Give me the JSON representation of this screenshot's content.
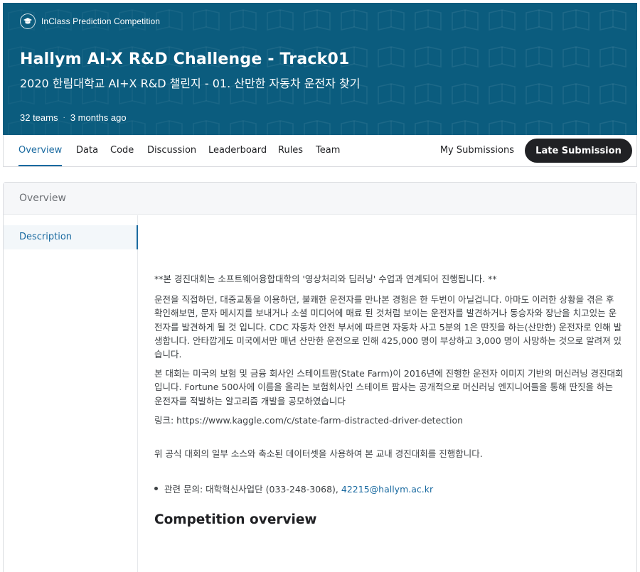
{
  "header": {
    "badge_label": "InClass Prediction Competition",
    "badge_icon": "graduation-cap-icon",
    "title": "Hallym AI-X R&D Challenge - Track01",
    "subtitle": "2020 한림대학교 AI+X R&D 챌린지 - 01. 산만한 자동차 운전자 찾기",
    "teams": "32 teams",
    "separator": "·",
    "age": "3 months ago",
    "banner_color": "#0b5c7e"
  },
  "tabs": [
    {
      "label": "Overview",
      "active": true
    },
    {
      "label": "Data"
    },
    {
      "label": "Code"
    },
    {
      "label": "Discussion"
    },
    {
      "label": "Leaderboard"
    },
    {
      "label": "Rules"
    },
    {
      "label": "Team"
    }
  ],
  "actions": {
    "my_submissions": "My Submissions",
    "late_submission": "Late Submission"
  },
  "overview": {
    "heading": "Overview",
    "sidebar": [
      {
        "label": "Description",
        "active": true
      }
    ],
    "intro": "**본 경진대회는 소프트웨어융합대학의 '영상처리와 딥러닝' 수업과 연계되어 진행됩니다. **",
    "p1": "운전을 직접하던, 대중교통을 이용하던, 불쾌한 운전자를 만나본 경험은 한 두번이 아닐겁니다. 아마도 이러한 상황을 겪은 후 확인해보면, 문자 메시지를 보내거나 소셜 미디어에 매료 된 것처럼 보이는 운전자를 발견하거나 동승자와 장난을 치고있는 운전자를 발견하게 될 것 입니다. CDC 자동차 안전 부서에 따르면 자동차 사고 5분의 1은 딴짓을 하는(산만한) 운전자로 인해 발생합니다. 안타깝게도 미국에서만 매년 산만한 운전으로 인해 425,000 명이 부상하고 3,000 명이 사망하는 것으로 알려져 있습니다.",
    "p2": "본 대회는 미국의 보험 및 금융 회사인 스테이트팜(State Farm)이 2016년에 진행한 운전자 이미지 기반의 머신러닝 경진대회입니다. Fortune 500사에 이름을 올리는 보험회사인 스테이트 팜사는 공개적으로 머신러닝 엔지니어들을 통해 딴짓을 하는 운전자를 적발하는 알고리즘 개발을 공모하였습니다",
    "link_line": "링크: https://www.kaggle.com/c/state-farm-distracted-driver-detection",
    "notice": "위 공식 대회의 일부 소스와 축소된 데이터셋을 사용하여 본 교내 경진대회를 진행합니다.",
    "contact_prefix": "관련 문의: 대학혁신사업단 (033-248-3068), ",
    "contact_email": "42215@hallym.ac.kr",
    "section_title": "Competition overview"
  }
}
